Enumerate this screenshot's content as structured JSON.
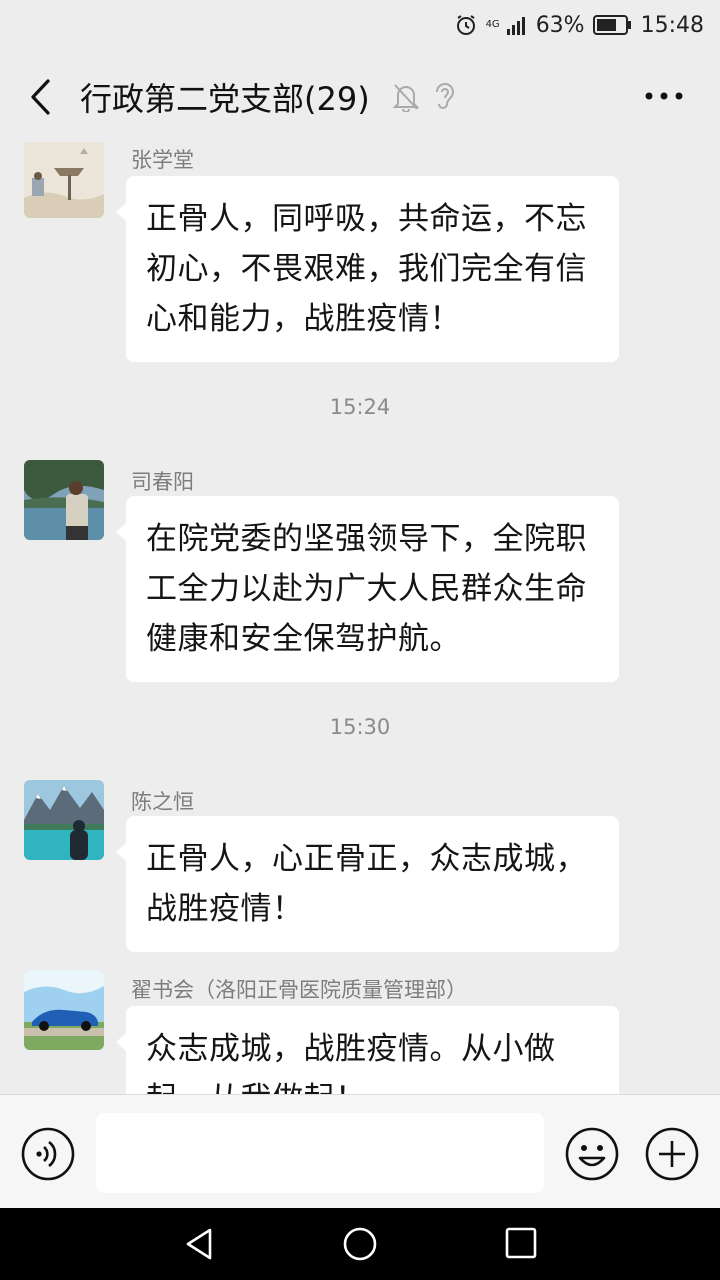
{
  "status_bar": {
    "network": "4G",
    "battery": "63%",
    "time": "15:48"
  },
  "header": {
    "title": "行政第二党支部(29)"
  },
  "messages": [
    {
      "sender": "张学堂",
      "text": "正骨人，同呼吸，共命运，不忘初心，不畏艰难，我们完全有信心和能力，战胜疫情！"
    },
    {
      "time": "15:24"
    },
    {
      "sender": "司春阳",
      "text": "在院党委的坚强领导下，全院职工全力以赴为广大人民群众生命健康和安全保驾护航。"
    },
    {
      "time": "15:30"
    },
    {
      "sender": "陈之恒",
      "text": "正骨人，心正骨正，众志成城，战胜疫情！"
    },
    {
      "sender": "翟书会（洛阳正骨医院质量管理部）",
      "text": "众志成城，战胜疫情。从小做起，从我做起！"
    }
  ],
  "input": {
    "placeholder": ""
  },
  "icons": {
    "back": "back-arrow-icon",
    "mute": "mute-bell-icon",
    "earpiece": "earpiece-icon",
    "more": "more-dots-icon",
    "voice": "voice-icon",
    "emoji": "emoji-icon",
    "plus": "plus-icon",
    "nav_back": "nav-back-icon",
    "nav_home": "nav-home-icon",
    "nav_recent": "nav-recent-icon"
  }
}
